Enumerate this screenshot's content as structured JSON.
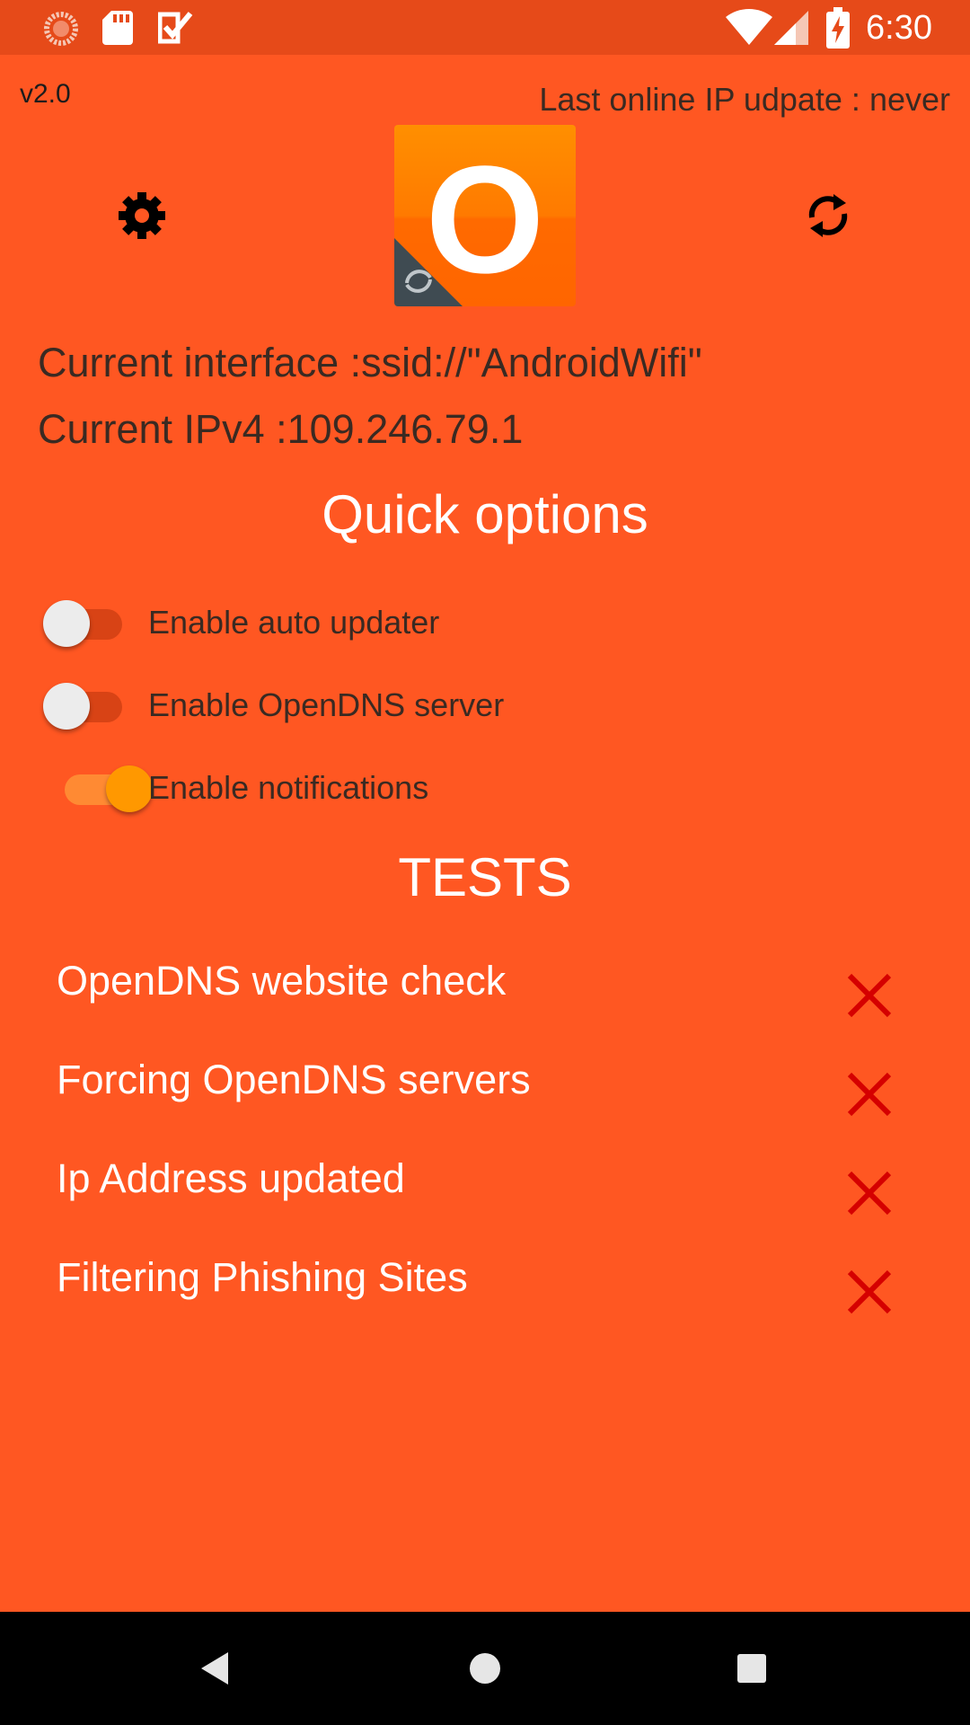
{
  "status_bar": {
    "time": "6:30",
    "left_icons": [
      "loading-spinner-icon",
      "sd-card-icon",
      "task-check-icon"
    ],
    "right_icons": [
      "wifi-icon",
      "cell-signal-icon",
      "battery-charging-icon"
    ]
  },
  "header": {
    "version": "v2.0",
    "last_update": "Last online IP udpate : never",
    "settings_icon": "gear-icon",
    "refresh_icon": "sync-icon",
    "logo_letter": "O"
  },
  "info": {
    "interface_label": "Current interface :",
    "interface_value": "ssid://\"AndroidWifi\"",
    "ipv4_label": "Current IPv4 :",
    "ipv4_value": "109.246.79.1"
  },
  "quick_options": {
    "title": "Quick options",
    "items": [
      {
        "label": "Enable auto updater",
        "enabled": false
      },
      {
        "label": "Enable OpenDNS server",
        "enabled": false
      },
      {
        "label": "Enable notifications",
        "enabled": true
      }
    ]
  },
  "tests": {
    "title": "TESTS",
    "items": [
      {
        "label": "OpenDNS website check",
        "status_icon": "x-icon"
      },
      {
        "label": "Forcing OpenDNS servers",
        "status_icon": "x-icon"
      },
      {
        "label": "Ip Address updated",
        "status_icon": "x-icon"
      },
      {
        "label": "Filtering Phishing Sites",
        "status_icon": "x-icon"
      }
    ]
  },
  "nav_bar": {
    "icons": [
      "back-icon",
      "home-icon",
      "recents-icon"
    ]
  },
  "colors": {
    "background": "#FF5722",
    "status_bar": "#E64A19",
    "switch_on": "#FF9800",
    "fail_red": "#D50000"
  }
}
